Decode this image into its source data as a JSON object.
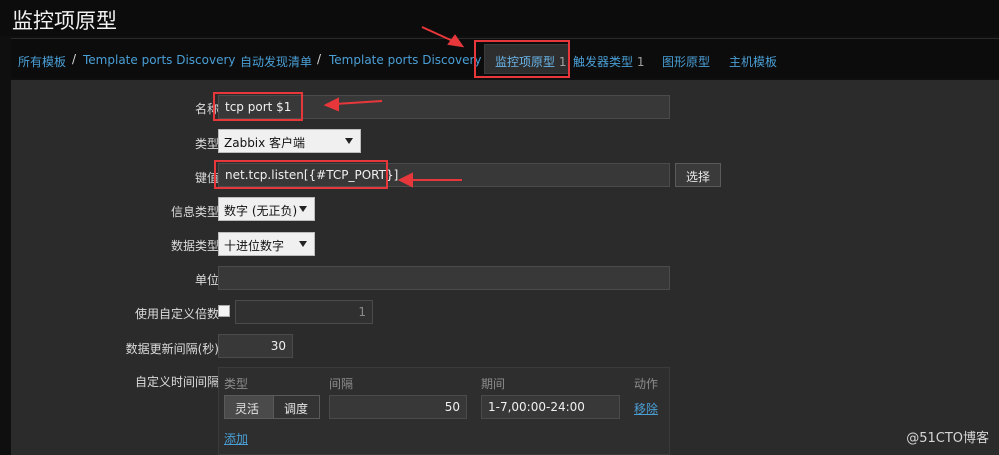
{
  "header": {
    "title": "监控项原型"
  },
  "breadcrumb": {
    "all_templates": "所有模板",
    "separator": "/",
    "template_1": "Template ports Discovery",
    "discovery_list": "自动发现清单",
    "template_2": "Template ports Discovery"
  },
  "tabs": {
    "item_prototypes": {
      "label": "监控项原型",
      "count": "1"
    },
    "trigger_prototypes": {
      "label": "触发器类型",
      "count": "1"
    },
    "graph_prototypes": {
      "label": "图形原型"
    },
    "host_templates": {
      "label": "主机模板"
    }
  },
  "form": {
    "name": {
      "label": "名称",
      "value": "tcp port $1"
    },
    "type": {
      "label": "类型",
      "value": "Zabbix 客户端"
    },
    "key": {
      "label": "键值",
      "value": "net.tcp.listen[{#TCP_PORT}]",
      "select_button": "选择"
    },
    "info_type": {
      "label": "信息类型",
      "value": "数字 (无正负)"
    },
    "data_type": {
      "label": "数据类型",
      "value": "十进位数字"
    },
    "units": {
      "label": "单位",
      "value": ""
    },
    "custom_multiplier": {
      "label": "使用自定义倍数",
      "value": "1"
    },
    "update_interval": {
      "label": "数据更新间隔(秒)",
      "value": "30"
    },
    "custom_intervals": {
      "label": "自定义时间间隔",
      "headers": {
        "type": "类型",
        "interval": "间隔",
        "period": "期间",
        "action": "动作"
      },
      "row": {
        "type_flexible": "灵活",
        "type_scheduling": "调度",
        "interval": "50",
        "period": "1-7,00:00-24:00",
        "remove": "移除"
      },
      "add": "添加"
    }
  },
  "watermark": "@51CTO博客",
  "colors": {
    "accent_link": "#4a9fd6",
    "highlight": "#e8373a"
  }
}
